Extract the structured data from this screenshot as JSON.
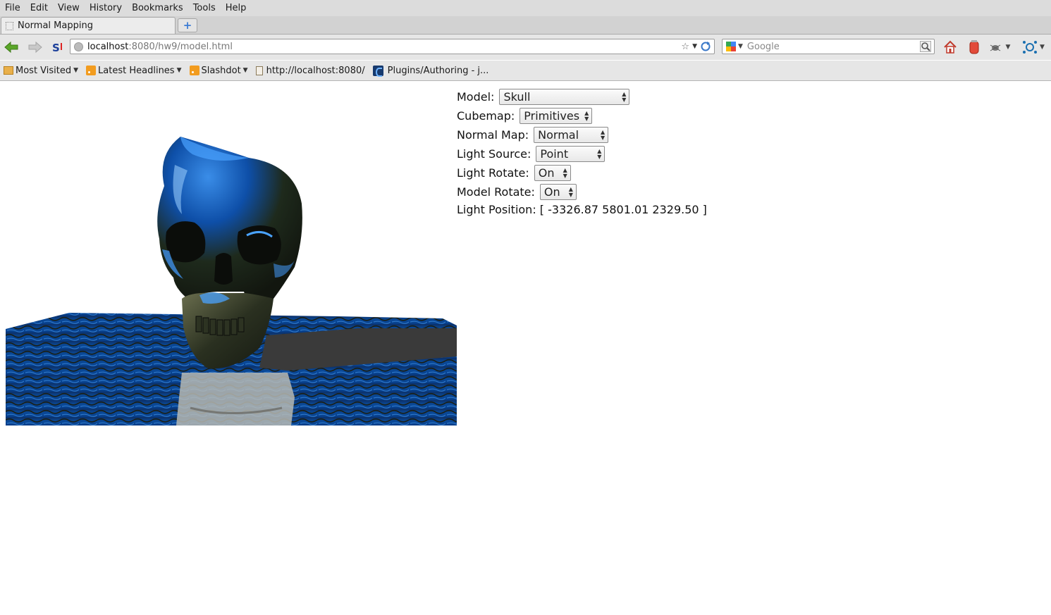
{
  "menubar": {
    "items": [
      {
        "label": "File"
      },
      {
        "label": "Edit"
      },
      {
        "label": "View"
      },
      {
        "label": "History"
      },
      {
        "label": "Bookmarks"
      },
      {
        "label": "Tools"
      },
      {
        "label": "Help"
      }
    ]
  },
  "tabs": {
    "active_title": "Normal Mapping",
    "new_tab_symbol": "+"
  },
  "navbar": {
    "url_host": "localhost",
    "url_rest": ":8080/hw9/model.html",
    "search_placeholder": "Google"
  },
  "bookmarks": {
    "items": [
      {
        "label": "Most Visited"
      },
      {
        "label": "Latest Headlines"
      },
      {
        "label": "Slashdot"
      },
      {
        "label": "http://localhost:8080/"
      },
      {
        "label": "Plugins/Authoring - j..."
      }
    ]
  },
  "controls": {
    "model": {
      "label": "Model:",
      "value": "Skull"
    },
    "cubemap": {
      "label": "Cubemap:",
      "value": "Primitives"
    },
    "normal_map": {
      "label": "Normal Map:",
      "value": "Normal"
    },
    "light_source": {
      "label": "Light Source:",
      "value": "Point"
    },
    "light_rotate": {
      "label": "Light Rotate:",
      "value": "On"
    },
    "model_rotate": {
      "label": "Model Rotate:",
      "value": "On"
    },
    "light_position": {
      "label": "Light Position:",
      "value": "[ -3326.87 5801.01 2329.50 ]"
    }
  },
  "colors": {
    "water_blue": "#0a3f86",
    "skull_metal": "#1e2a1c",
    "shadow": "#3a3a3a"
  }
}
